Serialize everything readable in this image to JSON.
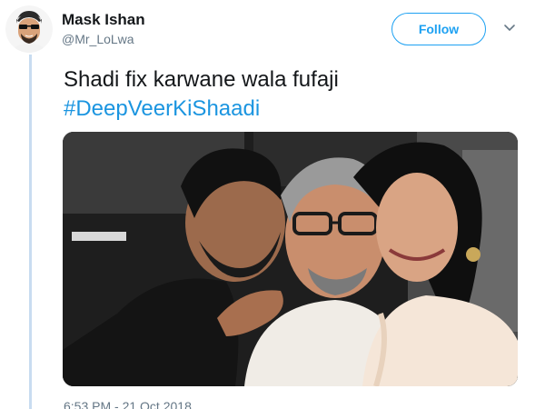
{
  "tweet": {
    "author_name": "Mask Ishan",
    "author_handle": "@Mr_LoLwa",
    "follow_label": "Follow",
    "text": "Shadi fix karwane wala fufaji",
    "hashtag": "#DeepVeerKiShaadi",
    "timestamp": "6:53 PM - 21 Oct 2018"
  },
  "colors": {
    "accent": "#1da1f2",
    "hashtag": "#1b95e0",
    "secondary_text": "#657786",
    "thread_line": "#c8dcf0"
  },
  "icons": {
    "avatar": "cartoon-avatar-icon",
    "menu": "chevron-down-icon"
  }
}
